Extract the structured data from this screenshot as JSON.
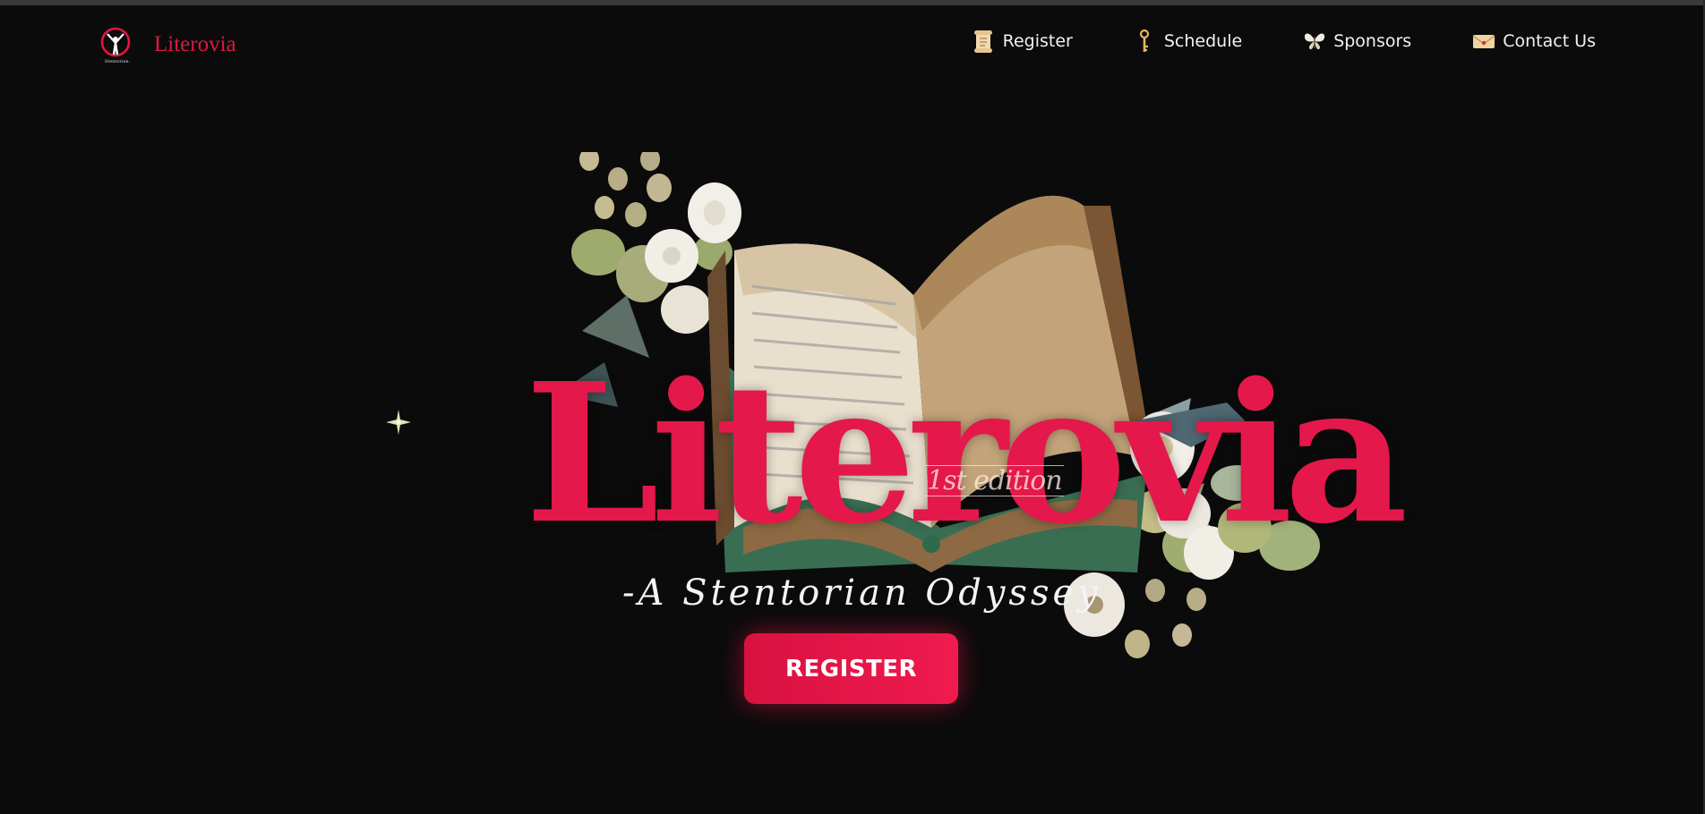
{
  "brand": {
    "logo_text": "Stentorian.",
    "name": "Literovia"
  },
  "nav": {
    "items": [
      {
        "label": "Register",
        "icon": "scroll-icon"
      },
      {
        "label": "Schedule",
        "icon": "key-icon"
      },
      {
        "label": "Sponsors",
        "icon": "butterfly-icon"
      },
      {
        "label": "Contact Us",
        "icon": "letter-icon"
      }
    ]
  },
  "hero": {
    "title": "Literovia",
    "edition": "1st edition",
    "tagline": "-A Stentorian Odyssey",
    "cta_label": "REGISTER"
  },
  "colors": {
    "background": "#0b0b0c",
    "accent": "#e4184a",
    "text": "#f2f2f2"
  }
}
